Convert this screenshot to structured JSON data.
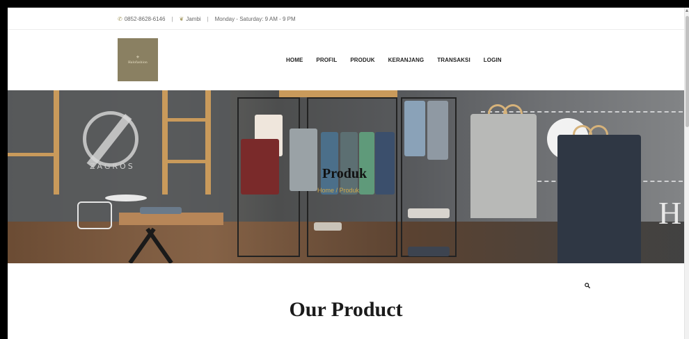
{
  "topbar": {
    "phone": "0852-8628-6146",
    "location": "Jambi",
    "hours": "Monday - Saturday: 9 AM - 9 PM",
    "separator": "|",
    "phone_icon": "phone-icon",
    "location_icon": "leaf-icon"
  },
  "header": {
    "logo_mark": "⚜",
    "logo_text": "Halofashion"
  },
  "nav": {
    "items": [
      {
        "label": "HOME"
      },
      {
        "label": "PROFIL"
      },
      {
        "label": "PRODUK"
      },
      {
        "label": "KERANJANG"
      },
      {
        "label": "TRANSAKSI"
      },
      {
        "label": "LOGIN"
      }
    ]
  },
  "hero": {
    "title": "Produk",
    "breadcrumb": "Home / Produk",
    "wall_brand": "ZAGROS",
    "wall_letter": "H"
  },
  "main": {
    "search_icon": "search-icon",
    "section_title": "Our Product"
  },
  "colors": {
    "accent": "#a59a63",
    "logo_bg": "#8a8062",
    "crumb": "#cfa84c"
  }
}
